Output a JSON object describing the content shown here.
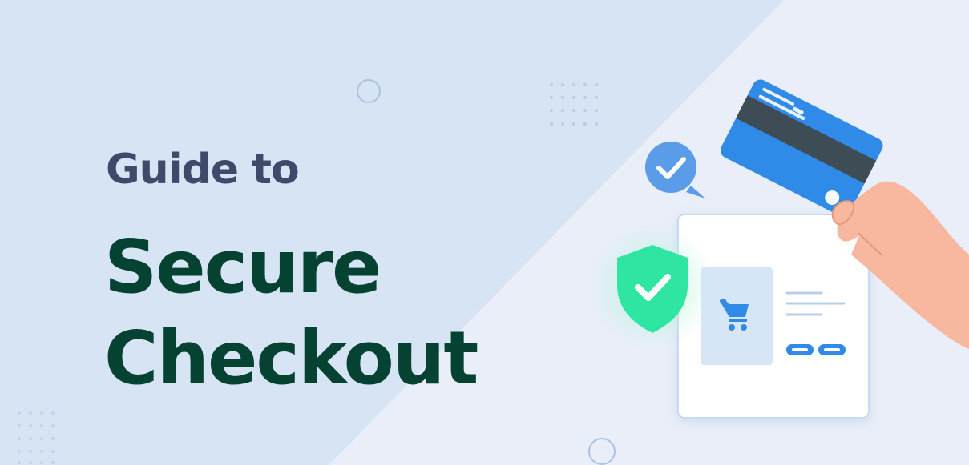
{
  "banner": {
    "subtitle": "Guide to",
    "title_line1": "Secure",
    "title_line2": "Checkout"
  },
  "illustration": {
    "icons": [
      "credit-card-icon",
      "hand-icon",
      "check-bubble-icon",
      "shield-check-icon",
      "shopping-cart-icon"
    ]
  },
  "colors": {
    "background_left": "#d6e4f3",
    "background_right": "#e9eef9",
    "subtitle_text": "#3f4a6b",
    "title_text": "#064232",
    "card_blue": "#2f8ae8",
    "card_stripe": "#3e4d55",
    "shield_green": "#2ee6a2",
    "bubble_blue": "#5b9ce8",
    "skin": "#f8b8a0"
  }
}
